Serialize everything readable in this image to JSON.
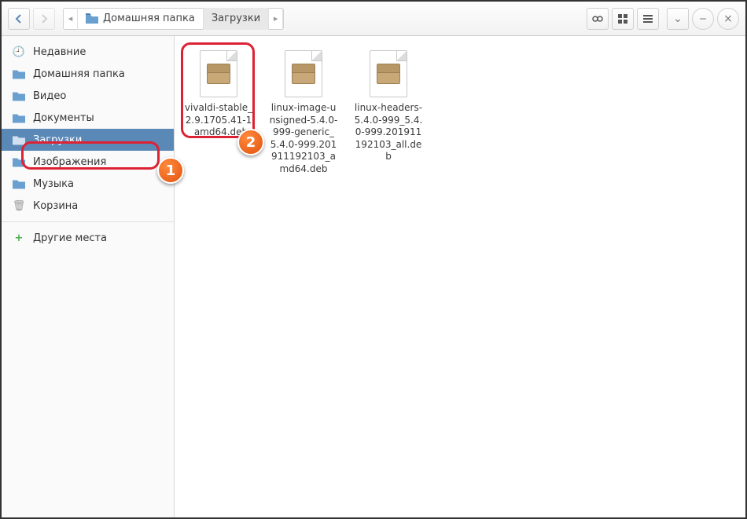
{
  "toolbar": {
    "back": "‹",
    "forward": "›",
    "breadcrumb": [
      {
        "label": "Домашняя папка",
        "active": false,
        "icon": true
      },
      {
        "label": "Загрузки",
        "active": true,
        "icon": false
      }
    ],
    "search_icon": "🔍",
    "view_icons_icon": "⊞",
    "view_list_icon": "≡",
    "menu_icon": "⌄"
  },
  "sidebar": {
    "items": [
      {
        "icon": "🕘",
        "label": "Недавние",
        "color": "#888"
      },
      {
        "icon": "folder",
        "label": "Домашняя папка",
        "color": "#6aa0d0"
      },
      {
        "icon": "folder",
        "label": "Видео",
        "color": "#6aa0d0"
      },
      {
        "icon": "folder",
        "label": "Документы",
        "color": "#6aa0d0"
      },
      {
        "icon": "folder",
        "label": "Загрузки",
        "color": "#6aa0d0",
        "selected": true
      },
      {
        "icon": "folder",
        "label": "Изображения",
        "color": "#6aa0d0"
      },
      {
        "icon": "folder",
        "label": "Музыка",
        "color": "#6aa0d0"
      },
      {
        "icon": "🗑",
        "label": "Корзина",
        "color": "#999"
      }
    ],
    "other": {
      "icon": "+",
      "label": "Другие места",
      "color": "#4caf50"
    }
  },
  "files": [
    {
      "name": "vivaldi-stable_2.9.1705.41-1_amd64.deb"
    },
    {
      "name": "linux-image-unsigned-5.4.0-999-generic_5.4.0-999.201911192103_amd64.deb"
    },
    {
      "name": "linux-headers-5.4.0-999_5.4.0-999.201911192103_all.deb"
    }
  ],
  "annotations": {
    "one": "1",
    "two": "2"
  }
}
